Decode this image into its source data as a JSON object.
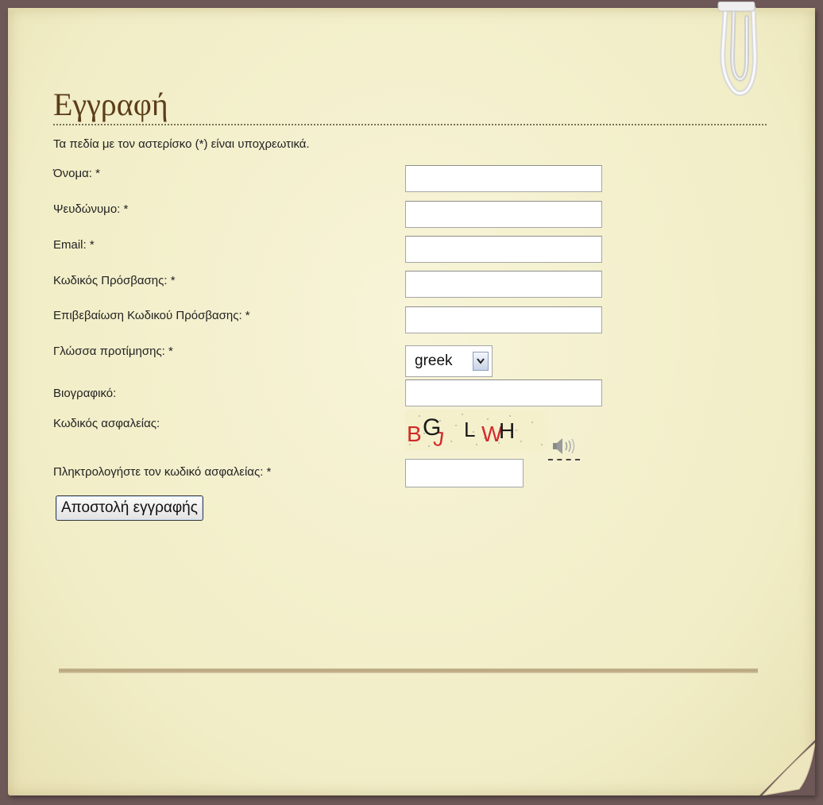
{
  "form": {
    "title": "Εγγραφή",
    "required_note": "Τα πεδία με τον αστερίσκο (*) είναι υποχρεωτικά.",
    "fields": [
      {
        "label": "Όνομα: *",
        "value": ""
      },
      {
        "label": "Ψευδώνυμο: *",
        "value": ""
      },
      {
        "label": "Email: *",
        "value": ""
      },
      {
        "label": "Κωδικός Πρόσβασης: *",
        "value": ""
      },
      {
        "label": "Επιβεβαίωση Κωδικού Πρόσβασης: *",
        "value": ""
      },
      {
        "label": "Γλώσσα προτίμησης: *",
        "value": "greek"
      },
      {
        "label": "Βιογραφικό:",
        "value": ""
      },
      {
        "label": "Κωδικός ασφαλείας:",
        "value": ""
      },
      {
        "label": "Πληκτρολογήστε τον κωδικό ασφαλείας: *",
        "value": ""
      }
    ],
    "captcha_text": "BGJLWH",
    "submit_label": "Αποστολή εγγραφής"
  },
  "icons": {
    "captcha_audio": "speaker-icon",
    "select_arrow": "chevron-down-icon",
    "decoration": "paper-clip-icon"
  },
  "colors": {
    "background": "#6d5757",
    "paper": "#f4f0cc",
    "title": "#5c3d19"
  }
}
